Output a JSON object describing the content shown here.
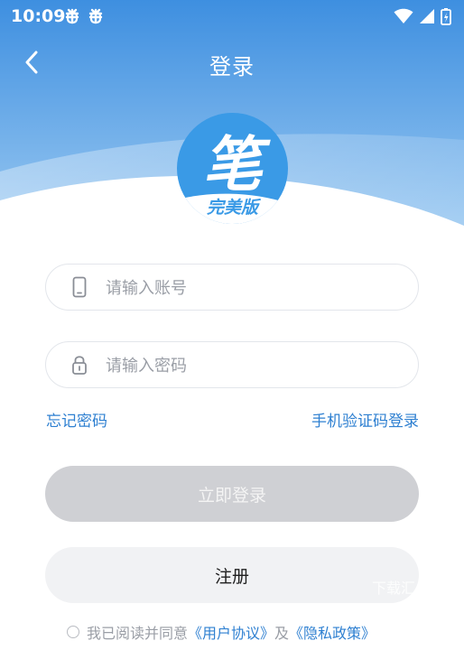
{
  "status_bar": {
    "time": "10:09",
    "notification_icons": [
      "bug-icon",
      "bug-icon"
    ],
    "system_icons": [
      "wifi-icon",
      "signal-icon",
      "battery-charging-icon"
    ]
  },
  "nav": {
    "title": "登录",
    "back_icon": "chevron-left-icon"
  },
  "logo": {
    "char": "笔",
    "edition": "完美版"
  },
  "form": {
    "account_placeholder": "请输入账号",
    "account_value": "",
    "account_icon": "phone-icon",
    "password_placeholder": "请输入密码",
    "password_value": "",
    "password_icon": "lock-icon"
  },
  "links": {
    "forgot_password": "忘记密码",
    "sms_login": "手机验证码登录"
  },
  "buttons": {
    "login": "立即登录",
    "register": "注册"
  },
  "watermark": "下载汇",
  "agreement": {
    "checked": false,
    "prefix": "我已阅读并同意",
    "user_agreement": "《用户协议》",
    "and": "及",
    "privacy_policy": "《隐私政策》"
  },
  "colors": {
    "header_gradient_top": "#3e8fe0",
    "header_gradient_bottom": "#a9d2f4",
    "accent": "#2f80d1",
    "logo_blue": "#3a9ae6",
    "login_button_disabled": "#cfd0d4",
    "register_button_bg": "#f1f2f4"
  }
}
